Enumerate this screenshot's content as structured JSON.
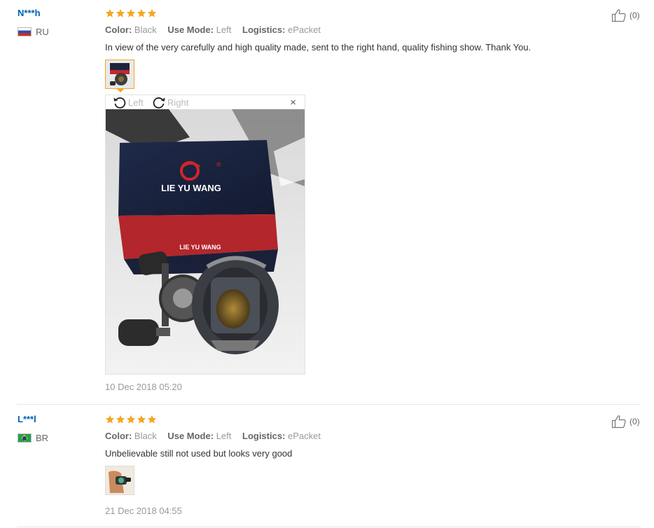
{
  "colors": {
    "star": "#f5a623",
    "username": "#0061b0",
    "muted": "#999999"
  },
  "reviews": [
    {
      "user": "N***h",
      "country_code": "RU",
      "flag_icon": "russia-flag-icon",
      "rating": 5,
      "attributes": [
        {
          "key": "Color:",
          "value": "Black"
        },
        {
          "key": "Use Mode:",
          "value": "Left"
        },
        {
          "key": "Logistics:",
          "value": "ePacket"
        }
      ],
      "text": "In view of the very carefully and high quality made, sent to the right hand, quality fishing show. Thank You.",
      "viewer": {
        "rotate_left_label": "Left",
        "rotate_right_label": "Right",
        "close_label": "×",
        "box_brand": "LIE YU WANG",
        "box_brand_small": "LIE YU WANG",
        "trademark": "®"
      },
      "date": "10 Dec 2018 05:20",
      "likes": "(0)"
    },
    {
      "user": "L***l",
      "country_code": "BR",
      "flag_icon": "brazil-flag-icon",
      "rating": 5,
      "attributes": [
        {
          "key": "Color:",
          "value": "Black"
        },
        {
          "key": "Use Mode:",
          "value": "Left"
        },
        {
          "key": "Logistics:",
          "value": "ePacket"
        }
      ],
      "text": "Unbelievable still not used but looks very good",
      "date": "21 Dec 2018 04:55",
      "likes": "(0)"
    }
  ]
}
